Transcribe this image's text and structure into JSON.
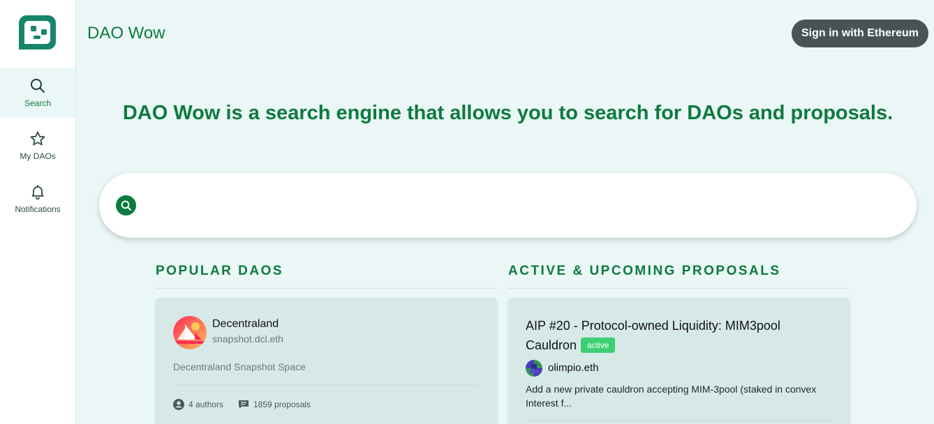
{
  "app": {
    "brand": "DAO Wow",
    "signin_label": "Sign in with Ethereum"
  },
  "sidebar": {
    "items": [
      {
        "label": "Search",
        "icon": "search-icon",
        "active": true
      },
      {
        "label": "My DAOs",
        "icon": "star-icon",
        "active": false
      },
      {
        "label": "Notifications",
        "icon": "bell-icon",
        "active": false
      }
    ]
  },
  "hero": {
    "headline": "DAO Wow is a search engine that allows you to search for DAOs and proposals."
  },
  "search": {
    "value": "",
    "placeholder": ""
  },
  "popular": {
    "title": "POPULAR DAOS",
    "cards": [
      {
        "name": "Decentraland",
        "handle": "snapshot.dcl.eth",
        "description": "Decentraland Snapshot Space",
        "authors": "4 authors",
        "proposals": "1859 proposals"
      }
    ]
  },
  "proposals": {
    "title": "ACTIVE & UPCOMING PROPOSALS",
    "cards": [
      {
        "title": "AIP #20 - Protocol-owned Liquidity: MIM3pool Cauldron",
        "status": "active",
        "author": "olimpio.eth",
        "body": "Add a new private cauldron accepting MIM-3pool (staked in convex Interest f..."
      }
    ]
  },
  "colors": {
    "accent": "#0e7a3e",
    "background": "#eaf7f6",
    "card": "#d7e9e7",
    "badge": "#3ecf74",
    "signin": "#475357"
  }
}
